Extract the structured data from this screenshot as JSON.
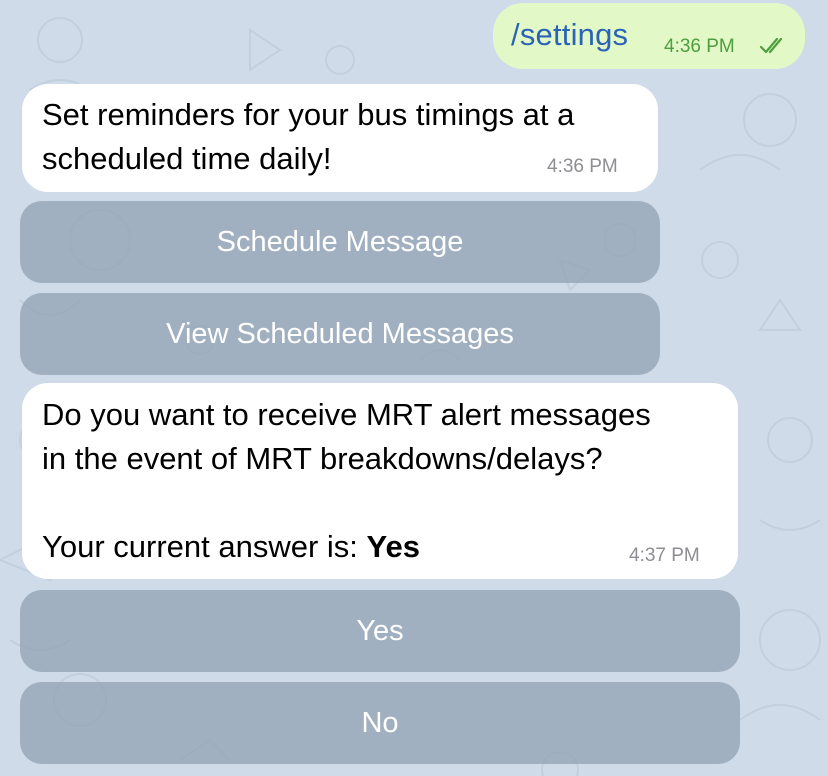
{
  "sent_message": {
    "text": "/settings",
    "time": "4:36 PM"
  },
  "reminder_message": {
    "line1": "Set reminders for your bus timings at a",
    "line2": "scheduled time daily!",
    "time": "4:36 PM"
  },
  "reminder_keyboard": [
    {
      "label": "Schedule Message"
    },
    {
      "label": "View Scheduled Messages"
    }
  ],
  "mrt_message": {
    "line1": "Do you want to receive MRT alert messages",
    "line2": "in the event of MRT breakdowns/delays?",
    "answer_prefix": "Your current answer is: ",
    "answer_value": "Yes",
    "time": "4:37 PM"
  },
  "mrt_keyboard": [
    {
      "label": "Yes"
    },
    {
      "label": "No"
    }
  ],
  "colors": {
    "background": "#cfdbe8",
    "outgoing_bubble": "#e2f9c7",
    "outgoing_text": "#2a64b8",
    "read_check": "#4e9e3f",
    "keyboard_button": "#8fa0b2"
  }
}
